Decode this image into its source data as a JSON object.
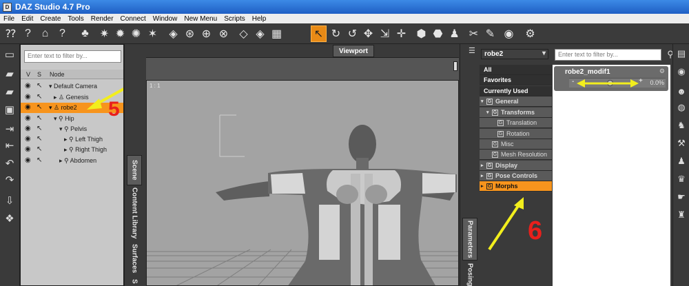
{
  "window": {
    "title": "DAZ Studio 4.7 Pro"
  },
  "menu": [
    "File",
    "Edit",
    "Create",
    "Tools",
    "Render",
    "Connect",
    "Window",
    "New Menu",
    "Scripts",
    "Help"
  ],
  "toolbar_icons": [
    "whats-this",
    "help",
    "home",
    "help-alt",
    "figure",
    "light-a",
    "light-b",
    "light-c",
    "light-d",
    "camera-a",
    "camera-b",
    "camera-c",
    "primitive-a",
    "primitive-b",
    "primitive-c",
    "primitive-d",
    "pointer",
    "rotate-a",
    "rotate-b",
    "universal",
    "scale",
    "translate",
    "node-tool",
    "surface-brush",
    "figure-tool",
    "joint-editor",
    "geometry-editor",
    "render-frame",
    "render-settings"
  ],
  "scene": {
    "filter_placeholder": "Enter text to filter by...",
    "columns": {
      "v": "V",
      "s": "S",
      "node": "Node"
    },
    "nodes": [
      {
        "label": "Default Camera",
        "selected": false
      },
      {
        "label": "Genesis",
        "selected": false
      },
      {
        "label": "robe2",
        "selected": true
      },
      {
        "label": "Hip",
        "selected": false
      },
      {
        "label": "Pelvis",
        "selected": false
      },
      {
        "label": "Left Thigh",
        "selected": false
      },
      {
        "label": "Right Thigh",
        "selected": false
      },
      {
        "label": "Abdomen",
        "selected": false
      }
    ],
    "annotation": "5"
  },
  "side_tabs": {
    "scene": "Scene",
    "content": "Content Library",
    "surfaces": "Surfaces",
    "extra": "S"
  },
  "viewport": {
    "tab": "Viewport",
    "label": "1 : 1"
  },
  "parameters": {
    "node_selector": "robe2",
    "filter_placeholder": "Enter text to filter by...",
    "tree": [
      {
        "label": "All"
      },
      {
        "label": "Favorites"
      },
      {
        "label": "Currently Used"
      },
      {
        "label": "General"
      },
      {
        "label": "Transforms"
      },
      {
        "label": "Translation"
      },
      {
        "label": "Rotation"
      },
      {
        "label": "Misc"
      },
      {
        "label": "Mesh Resolution"
      },
      {
        "label": "Display"
      },
      {
        "label": "Pose Controls"
      },
      {
        "label": "Morphs"
      }
    ],
    "group_glyph": "G",
    "property": {
      "name": "robe2_modif1",
      "minus": "-",
      "plus": "+",
      "value": "0.0%",
      "level": 0
    },
    "annotation": "6",
    "tabs": {
      "params": "Parameters",
      "posing": "Posing"
    }
  },
  "colors": {
    "selection": "#f7941d",
    "annotation_red": "#e8201c",
    "annotation_yellow": "#f2ee1d"
  }
}
